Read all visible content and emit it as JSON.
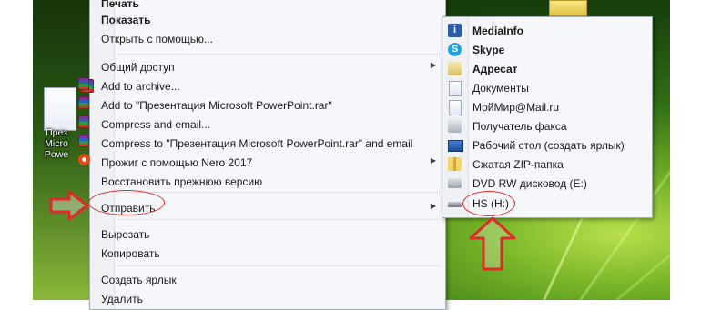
{
  "desktop": {
    "file_label": "През\nMicro\nPowe"
  },
  "context_menu": {
    "items": [
      {
        "label": "Печать",
        "bold": true
      },
      {
        "label": "Показать",
        "bold": true
      },
      {
        "label": "Открыть с помощью...",
        "bold": false
      },
      {
        "label": "Общий доступ",
        "bold": false,
        "submenu": true
      },
      {
        "label": "Add to archive...",
        "icon": "winrar-icon"
      },
      {
        "label": "Add to \"Презентация Microsoft PowerPoint.rar\"",
        "icon": "winrar-icon"
      },
      {
        "label": "Compress and email...",
        "icon": "winrar-icon"
      },
      {
        "label": "Compress to \"Презентация Microsoft PowerPoint.rar\" and email",
        "icon": "winrar-icon"
      },
      {
        "label": "Прожиг с помощью Nero 2017",
        "icon": "nero-icon",
        "submenu": true
      },
      {
        "label": "Восстановить прежнюю версию"
      },
      {
        "label": "Отправить",
        "submenu": true,
        "highlighted": true
      },
      {
        "label": "Вырезать"
      },
      {
        "label": "Копировать"
      },
      {
        "label": "Создать ярлык"
      },
      {
        "label": "Удалить"
      }
    ]
  },
  "send_to_menu": {
    "items": [
      {
        "label": "MediaInfo",
        "bold": true,
        "icon": "mediainfo-icon"
      },
      {
        "label": "Skype",
        "bold": true,
        "icon": "skype-icon"
      },
      {
        "label": "Адресат",
        "bold": true,
        "icon": "mail-recipient-icon"
      },
      {
        "label": "Документы",
        "icon": "documents-icon"
      },
      {
        "label": "МойМир@Mail.ru",
        "icon": "moimir-icon"
      },
      {
        "label": "Получатель факса",
        "icon": "fax-icon"
      },
      {
        "label": "Рабочий стол (создать ярлык)",
        "icon": "desktop-icon"
      },
      {
        "label": "Сжатая ZIP-папка",
        "icon": "zip-folder-icon"
      },
      {
        "label": "DVD RW дисковод (E:)",
        "icon": "dvd-drive-icon"
      },
      {
        "label": "HS (H:)",
        "icon": "usb-drive-icon",
        "highlighted": true
      }
    ]
  },
  "colors": {
    "annotation_red": "#e02a2a",
    "menu_bg": "#f6f7fa"
  }
}
